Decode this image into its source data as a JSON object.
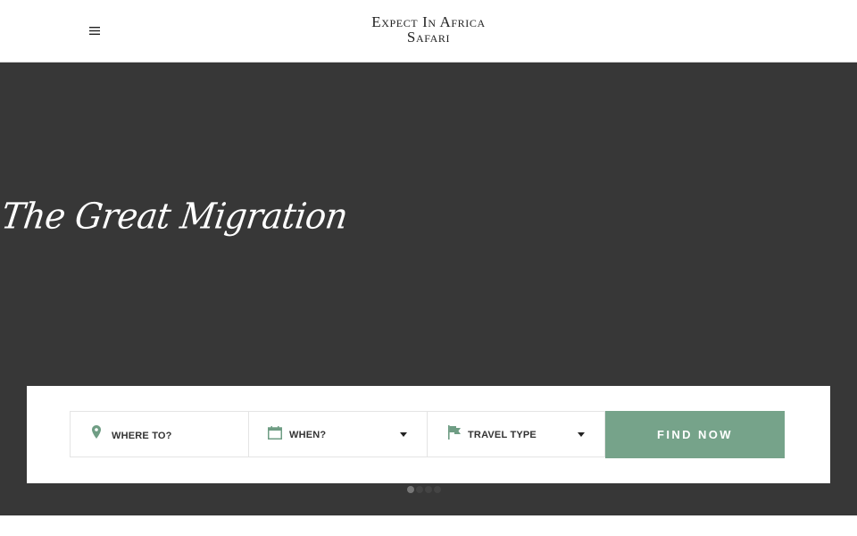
{
  "header": {
    "logo_line1": "Expect In Africa",
    "logo_line2": "Safari",
    "menu_icon": "hamburger-menu-icon"
  },
  "hero": {
    "title": "The Great Migration",
    "background_color": "#373737"
  },
  "search": {
    "fields": [
      {
        "label": "WHERE TO?",
        "icon": "map-pin-icon"
      },
      {
        "label": "WHEN?",
        "icon": "calendar-icon"
      },
      {
        "label": "TRAVEL TYPE",
        "icon": "flag-icon"
      }
    ],
    "button_label": "FIND NOW",
    "accent_color": "#76a38a"
  },
  "slider": {
    "dot_count": 4,
    "active_index": 0
  }
}
